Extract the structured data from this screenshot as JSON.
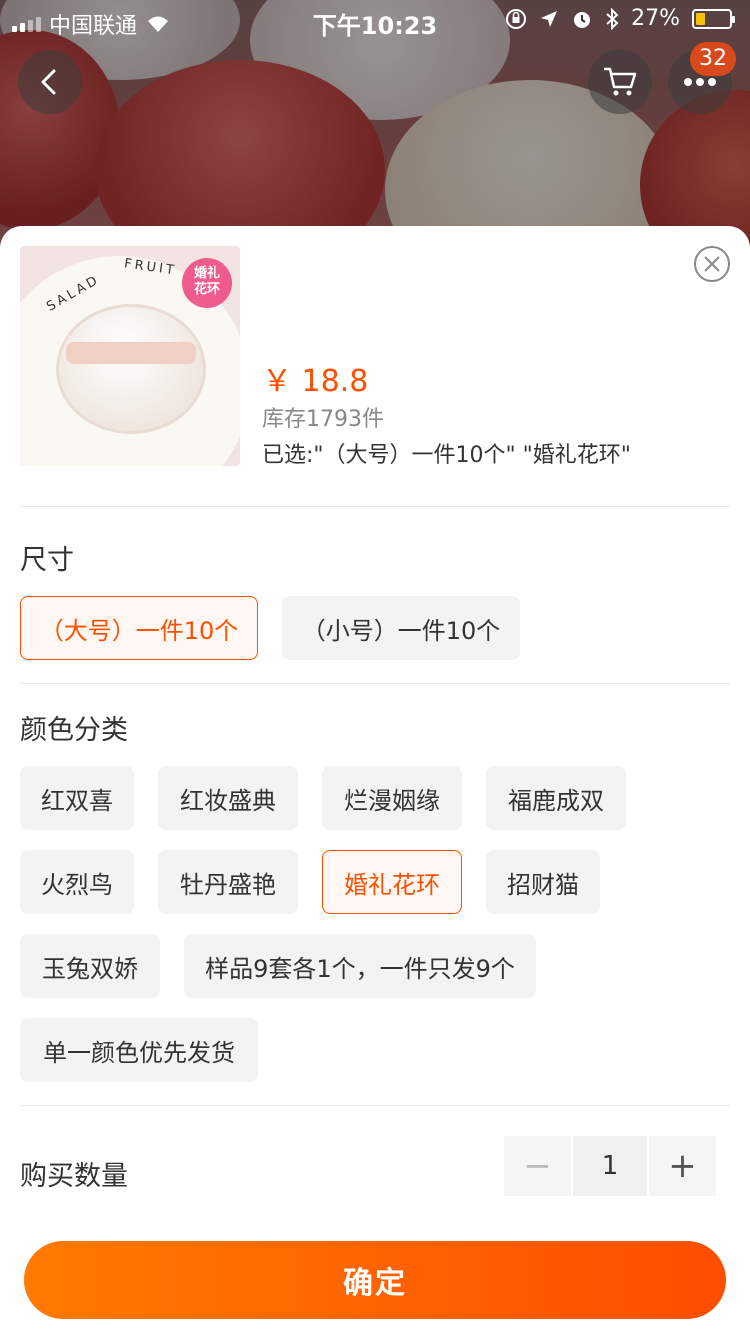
{
  "status_bar": {
    "carrier": "中国联通",
    "time": "下午10:23",
    "battery_text": "27%",
    "battery_level": 0.27
  },
  "nav": {
    "badge_count": "32",
    "icons": [
      "back-arrow-icon",
      "cart-icon",
      "more-dots-icon"
    ]
  },
  "product": {
    "thumb_tag": "婚礼\n花环",
    "thumb_words": [
      "SALAD",
      "FRUIT"
    ],
    "price": "￥ 18.8",
    "stock": "库存1793件",
    "selected": "已选:\"（大号）一件10个\" \"婚礼花环\""
  },
  "size": {
    "title": "尺寸",
    "options": [
      {
        "label": "（大号）一件10个",
        "active": true
      },
      {
        "label": "（小号）一件10个",
        "active": false
      }
    ]
  },
  "color": {
    "title": "颜色分类",
    "options": [
      {
        "label": "红双喜"
      },
      {
        "label": "红妆盛典"
      },
      {
        "label": "烂漫姻缘"
      },
      {
        "label": "福鹿成双"
      },
      {
        "label": "火烈鸟"
      },
      {
        "label": "牡丹盛艳"
      },
      {
        "label": "婚礼花环",
        "active": true
      },
      {
        "label": "招财猫"
      },
      {
        "label": "玉兔双娇"
      },
      {
        "label": "样品9套各1个，一件只发9个"
      },
      {
        "label": "单一颜色优先发货"
      }
    ]
  },
  "quantity": {
    "label": "购买数量",
    "value": "1",
    "minus": "−",
    "plus": "+"
  },
  "confirm_label": "确定",
  "colors": {
    "accent": "#ff5000",
    "badge": "#d84a1b",
    "tag": "#ef5b8d"
  }
}
